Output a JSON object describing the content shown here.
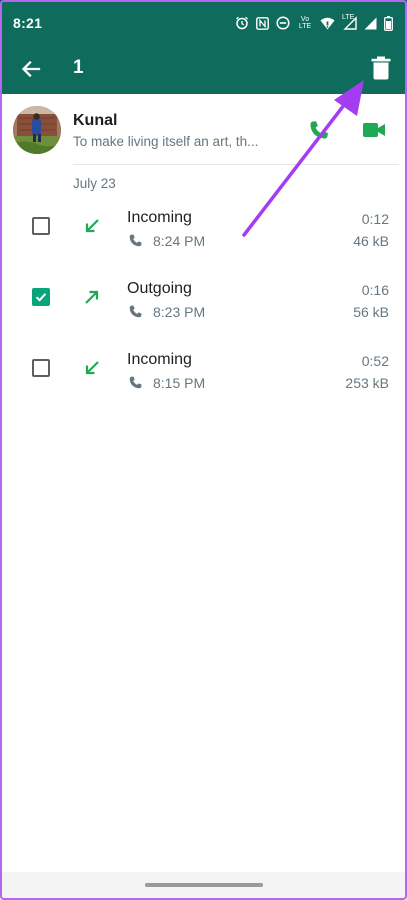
{
  "status_bar": {
    "time": "8:21",
    "icons": [
      "alarm-icon",
      "nfc-icon",
      "do-not-disturb-icon",
      "volte-icon",
      "wifi-icon",
      "lte-signal-icon",
      "signal-icon",
      "battery-icon"
    ],
    "volte_label": "Vo LTE",
    "lte_label": "LTE"
  },
  "app_bar": {
    "selected_count": "1",
    "back_icon": "arrow-left-icon",
    "delete_icon": "trash-icon"
  },
  "contact": {
    "name": "Kunal",
    "status": "To make living itself an art, th...",
    "voice_call_icon": "phone-icon",
    "video_call_icon": "video-camera-icon"
  },
  "date_header": "July 23",
  "calls": [
    {
      "type": "Incoming",
      "direction": "incoming",
      "time": "8:24 PM",
      "duration": "0:12",
      "size": "46 kB",
      "checked": false
    },
    {
      "type": "Outgoing",
      "direction": "outgoing",
      "time": "8:23 PM",
      "duration": "0:16",
      "size": "56 kB",
      "checked": true
    },
    {
      "type": "Incoming",
      "direction": "incoming",
      "time": "8:15 PM",
      "duration": "0:52",
      "size": "253 kB",
      "checked": false
    }
  ],
  "colors": {
    "header": "#0f6b5c",
    "accent_green": "#08a57d",
    "call_icon_green": "#1fa855",
    "secondary_text": "#667781",
    "annotation_arrow": "#a43df2"
  }
}
